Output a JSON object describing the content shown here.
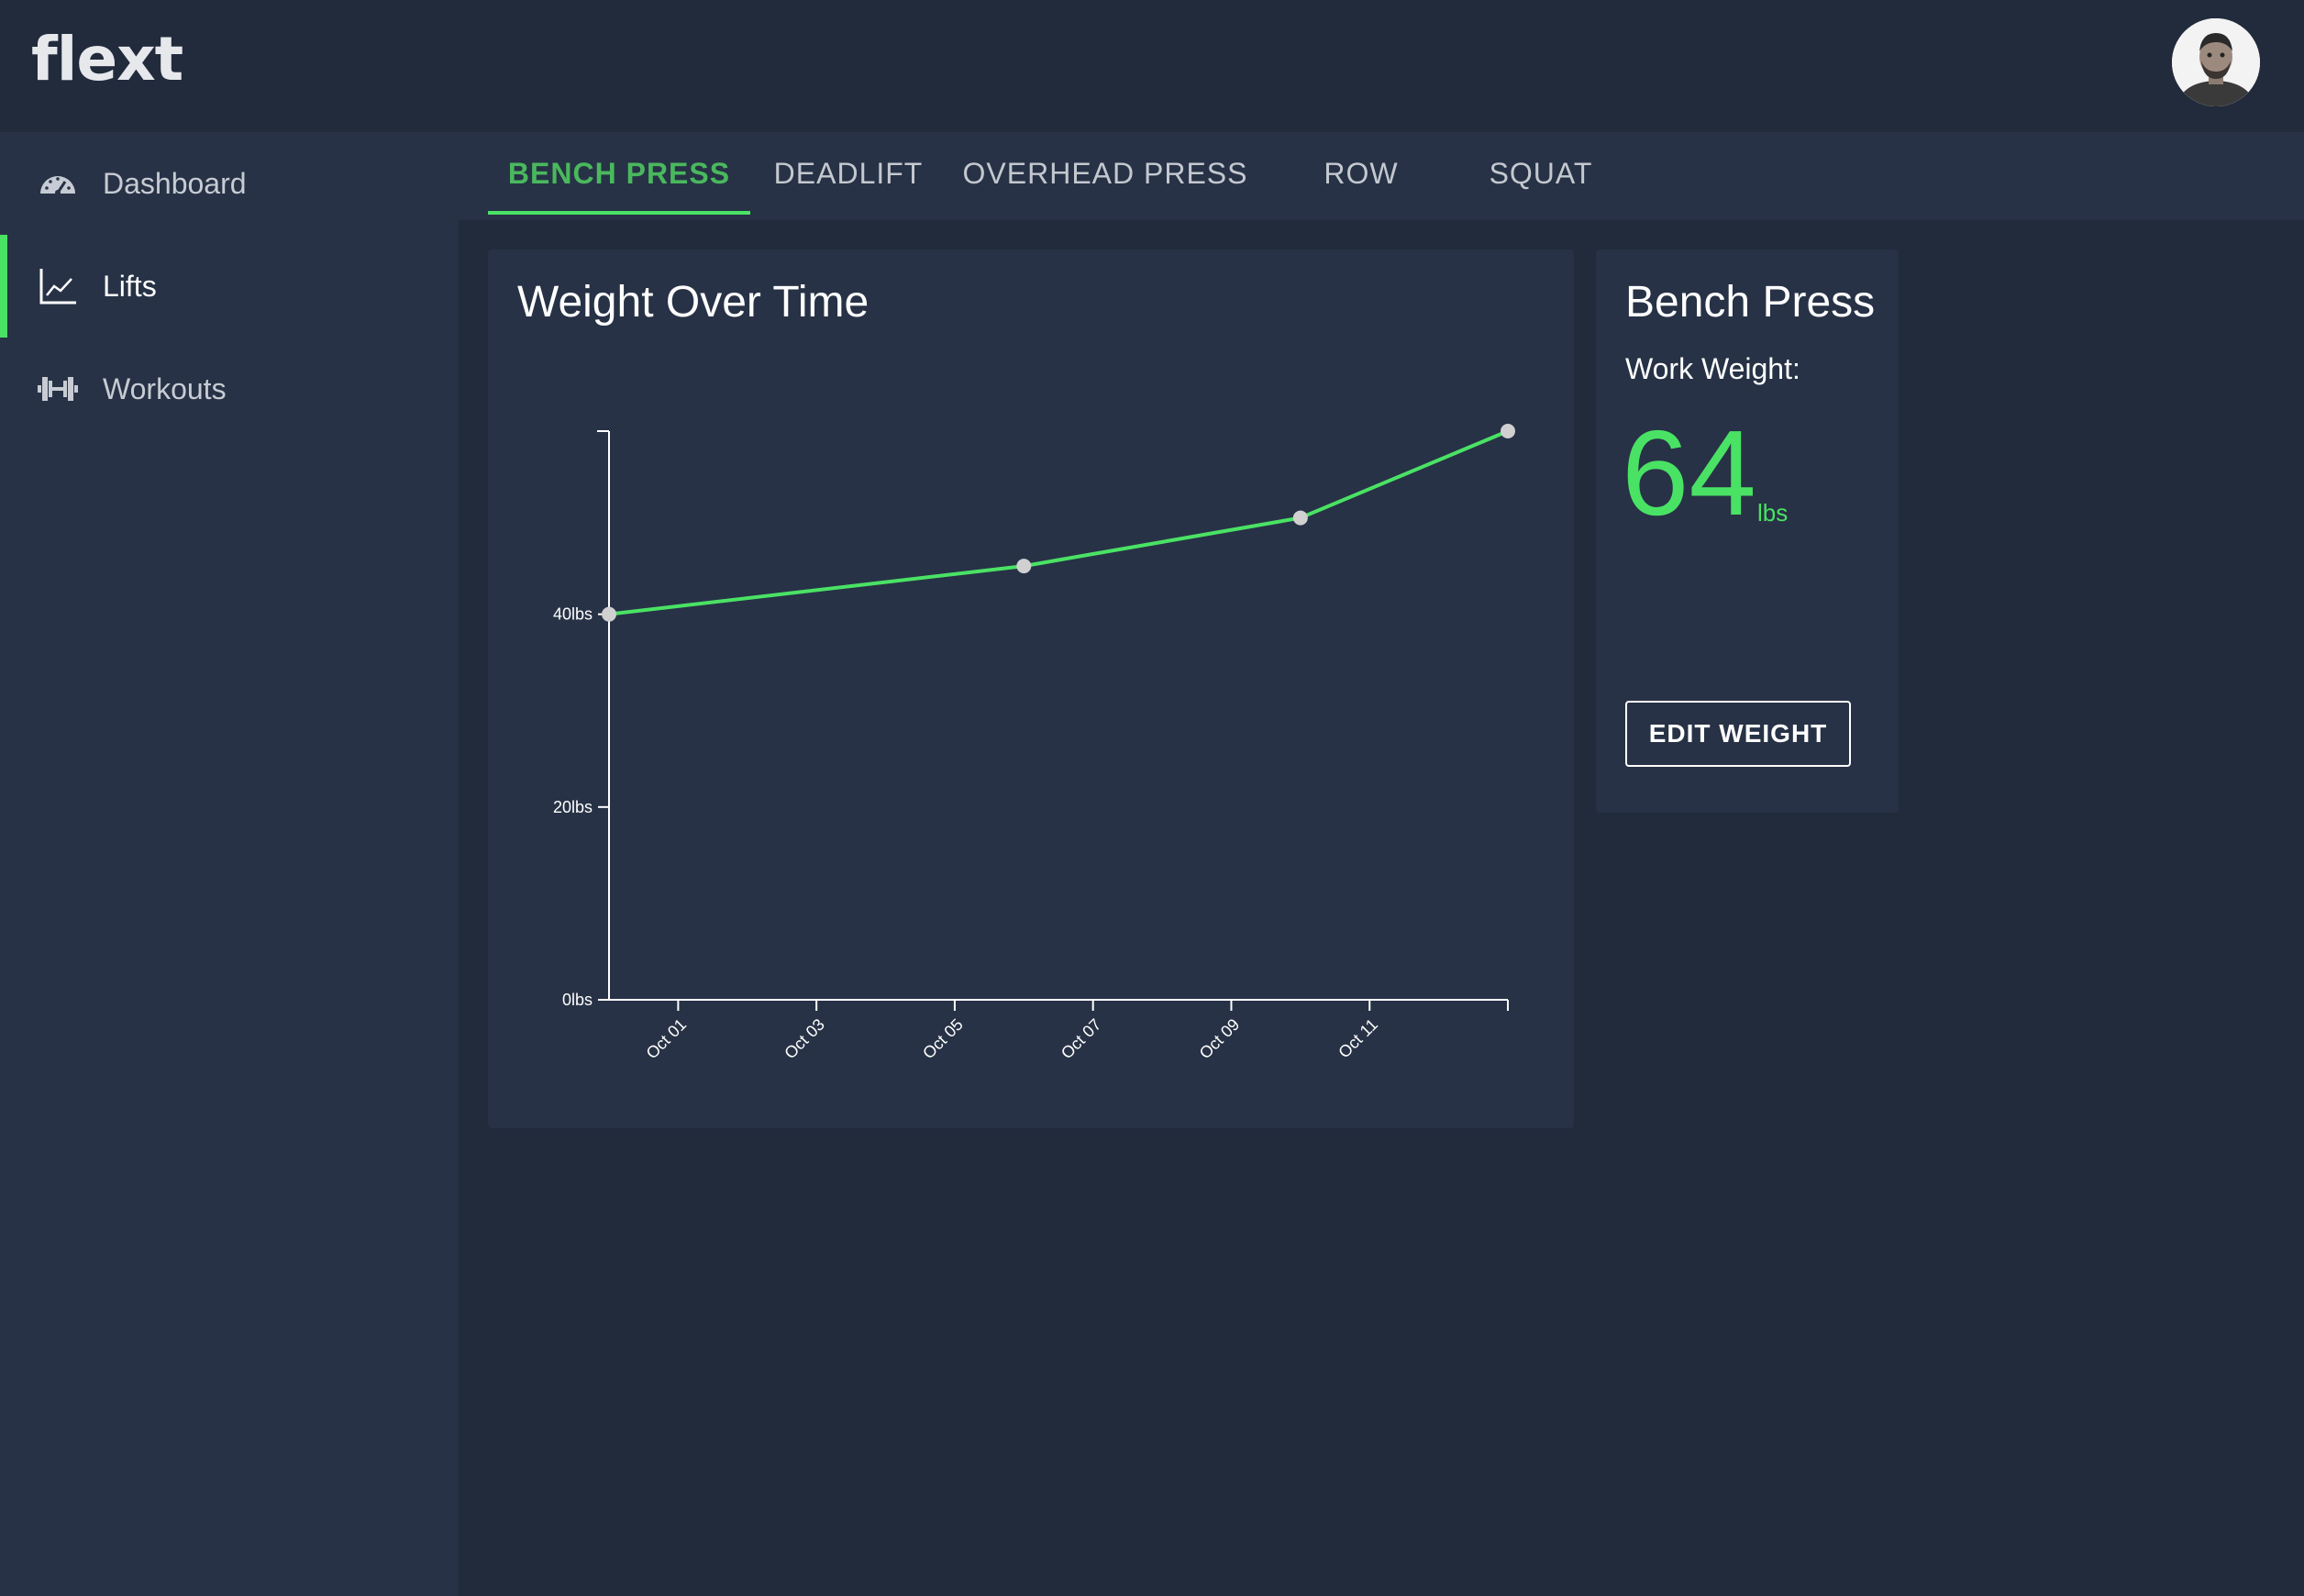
{
  "app": {
    "logo": "flext"
  },
  "sidebar": {
    "items": [
      {
        "label": "Dashboard",
        "icon": "speedometer-icon"
      },
      {
        "label": "Lifts",
        "icon": "line-chart-icon"
      },
      {
        "label": "Workouts",
        "icon": "dumbbell-icon"
      }
    ],
    "active": "Lifts"
  },
  "tabs": {
    "items": [
      "BENCH PRESS",
      "DEADLIFT",
      "OVERHEAD PRESS",
      "ROW",
      "SQUAT"
    ],
    "active": "BENCH PRESS"
  },
  "chart_card": {
    "title": "Weight Over Time"
  },
  "info_card": {
    "title": "Bench Press",
    "subtitle": "Work Weight:",
    "value": "64",
    "unit": "lbs",
    "button": "EDIT WEIGHT"
  },
  "colors": {
    "accent": "#4ae264",
    "background": "#222b3c",
    "panel": "#273246"
  },
  "chart_data": {
    "type": "line",
    "title": "Weight Over Time",
    "xlabel": "",
    "ylabel": "",
    "x": [
      "Sep 30",
      "Oct 06",
      "Oct 10",
      "Oct 13"
    ],
    "series": [
      {
        "values": [
          40,
          45,
          50,
          59
        ]
      }
    ],
    "xticks": [
      "Oct 01",
      "Oct 03",
      "Oct 05",
      "Oct 07",
      "Oct 09",
      "Oct 11"
    ],
    "yticks": [
      "0lbs",
      "20lbs",
      "40lbs"
    ],
    "ylim": [
      0,
      59
    ],
    "grid": false
  }
}
